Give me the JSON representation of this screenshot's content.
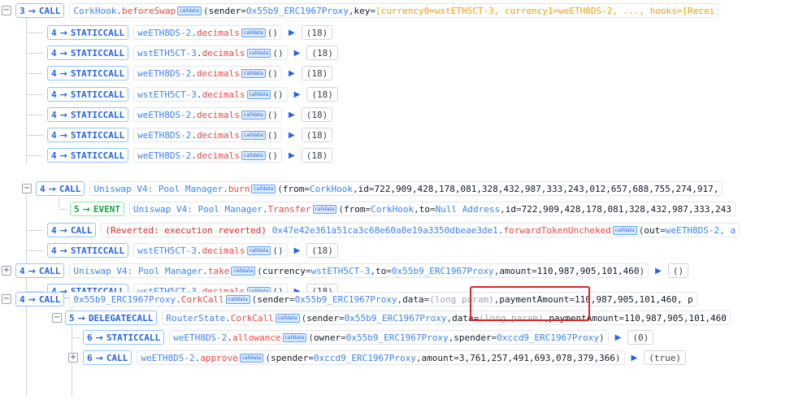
{
  "calldata_label": "calldata",
  "rows": {
    "r0": {
      "depth": "3",
      "type": "CALL",
      "contract": "CorkHook",
      "method": "beforeSwap",
      "open": "(",
      "k1": "sender",
      "v1": "0x55b9_ERC1967Proxy",
      "k2": "key",
      "v2": "[currency0=wstETH5CT-3, currency1=weETH8DS-2, ..., hooks=[Recei"
    },
    "r1": {
      "depth": "4",
      "type": "STATICCALL",
      "contract": "weETH8DS-2",
      "method": "decimals",
      "args": "()",
      "ret": "(18)"
    },
    "r2": {
      "depth": "4",
      "type": "STATICCALL",
      "contract": "wstETH5CT-3",
      "method": "decimals",
      "args": "()",
      "ret": "(18)"
    },
    "r3": {
      "depth": "4",
      "type": "STATICCALL",
      "contract": "weETH8DS-2",
      "method": "decimals",
      "args": "()",
      "ret": "(18)"
    },
    "r4": {
      "depth": "4",
      "type": "STATICCALL",
      "contract": "wstETH5CT-3",
      "method": "decimals",
      "args": "()",
      "ret": "(18)"
    },
    "r5": {
      "depth": "4",
      "type": "STATICCALL",
      "contract": "weETH8DS-2",
      "method": "decimals",
      "args": "()",
      "ret": "(18)"
    },
    "r6": {
      "depth": "4",
      "type": "STATICCALL",
      "contract": "weETH8DS-2",
      "method": "decimals",
      "args": "()",
      "ret": "(18)"
    },
    "r7": {
      "depth": "4",
      "type": "STATICCALL",
      "contract": "weETH8DS-2",
      "method": "decimals",
      "args": "()",
      "ret": "(18)"
    },
    "r8": {
      "depth": "4",
      "type": "CALL",
      "contract": "Uniswap V4: Pool Manager",
      "method": "burn",
      "open": "(",
      "k1": "from",
      "v1": "CorkHook",
      "k2": "id",
      "v2": "722,909,428,178,081,328,432,987,333,243,012,657,688,755,274,917,"
    },
    "r9": {
      "depth": "5",
      "type": "EVENT",
      "contract": "Uniswap V4: Pool Manager",
      "method": "Transfer",
      "open": "(",
      "k1": "from",
      "v1": "CorkHook",
      "k2": "to",
      "v2": "Null Address",
      "k3": "id",
      "v3": "722,909,428,178,081,328,432,987,333,243"
    },
    "r10": {
      "depth": "4",
      "type": "CALL",
      "reverted": "(Reverted: execution reverted)",
      "addr": "0x47e42e361a51ca3c68e60a0e19a3350dbeae3de1",
      "method": "forwardTokenUncheked",
      "open": "(",
      "k1": "out",
      "v1": "weETH8DS-2, a"
    },
    "r11": {
      "depth": "4",
      "type": "STATICCALL",
      "contract": "wstETH5CT-3",
      "method": "decimals",
      "args": "()",
      "ret": "(18)"
    },
    "r12": {
      "depth": "4",
      "type": "CALL",
      "contract": "Uniswap V4: Pool Manager",
      "method": "take",
      "open": "(",
      "k1": "currency",
      "v1": "wstETH5CT-3",
      "k2": "to",
      "v2": "0x55b9_ERC1967Proxy",
      "k3": "amount",
      "v3": "110,987,905,101,460",
      "close": ")",
      "ret": "()"
    },
    "r13": {
      "depth": "4",
      "type": "STATICCALL",
      "contract": "wstETH5CT-3",
      "method": "decimals",
      "args": "()",
      "ret": "(18)"
    },
    "r14": {
      "depth": "4",
      "type": "CALL",
      "contract": "0x55b9_ERC1967Proxy",
      "method": "CorkCall",
      "open": "(",
      "k1": "sender",
      "v1": "0x55b9_ERC1967Proxy",
      "k2": "data",
      "v2": "(long param)",
      "k3": "paymentAmount",
      "v3": "110,987,905,101,460, p"
    },
    "r15": {
      "depth": "5",
      "type": "DELEGATECALL",
      "contract": "RouterState",
      "method": "CorkCall",
      "open": "(",
      "k1": "sender",
      "v1": "0x55b9_ERC1967Proxy",
      "k2": "data",
      "v2": "(long param)",
      "k3": "paymentAmount",
      "v3": "110,987,905,101,460"
    },
    "r16": {
      "depth": "6",
      "type": "STATICCALL",
      "contract": "weETH8DS-2",
      "method": "allowance",
      "open": "(",
      "k1": "owner",
      "v1": "0x55b9_ERC1967Proxy",
      "k2": "spender",
      "v2": "0xccd9_ERC1967Proxy",
      "close": ")",
      "ret": "(0)"
    },
    "r17": {
      "depth": "6",
      "type": "CALL",
      "contract": "weETH8DS-2",
      "method": "approve",
      "open": "(",
      "k1": "spender",
      "v1": "0xccd9_ERC1967Proxy",
      "k2": "amount",
      "v2": "3,761,257,491,693,078,379,366",
      "close": ")",
      "ret": "(true)"
    }
  }
}
